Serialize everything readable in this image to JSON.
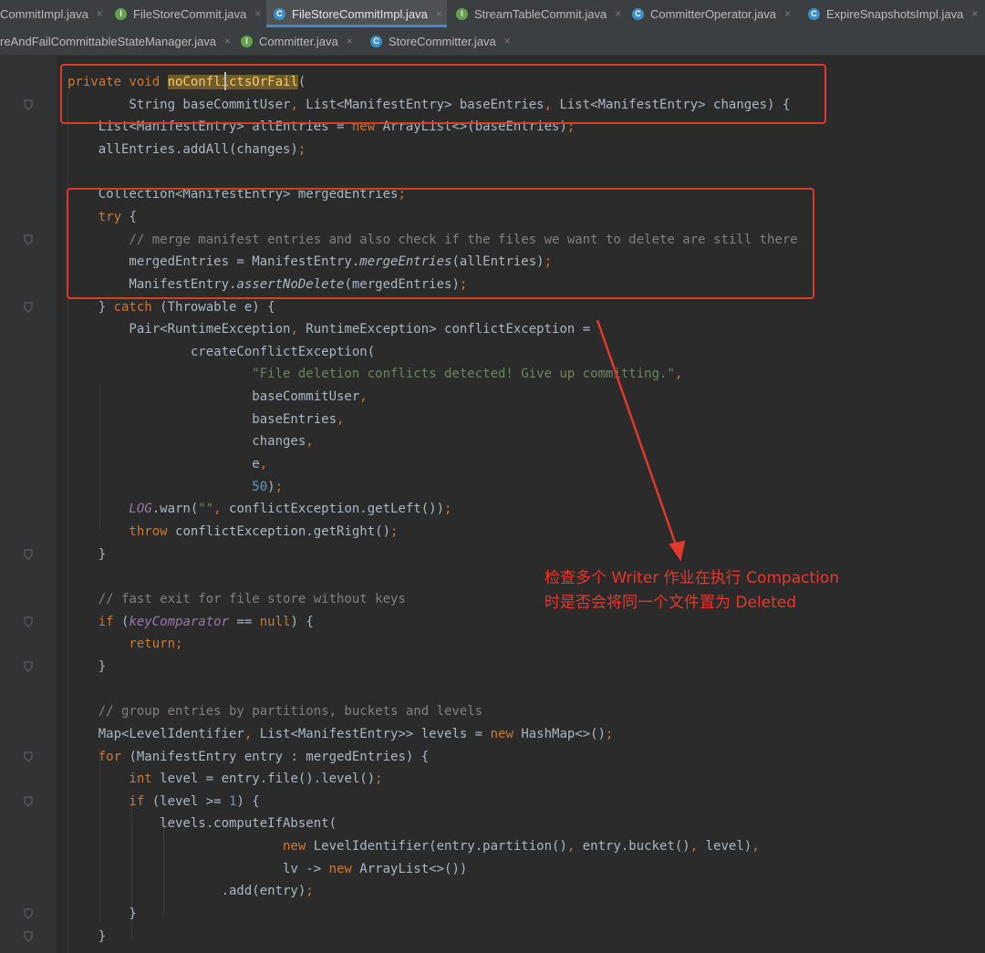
{
  "tabs_row1": [
    {
      "label": "CommitImpl.java",
      "icon": "class-icon",
      "active": false
    },
    {
      "label": "FileStoreCommit.java",
      "icon": "interface-icon",
      "active": false
    },
    {
      "label": "FileStoreCommitImpl.java",
      "icon": "class-icon",
      "active": true
    },
    {
      "label": "StreamTableCommit.java",
      "icon": "interface-icon",
      "active": false
    },
    {
      "label": "CommitterOperator.java",
      "icon": "class-icon",
      "active": false
    },
    {
      "label": "ExpireSnapshotsImpl.java",
      "icon": "class-icon",
      "active": false
    }
  ],
  "tabs_row2": [
    {
      "label": "reAndFailCommittableStateManager.java",
      "icon": "class-icon",
      "active": false
    },
    {
      "label": "Committer.java",
      "icon": "interface-icon",
      "active": false
    },
    {
      "label": "StoreCommitter.java",
      "icon": "class-icon",
      "active": false
    }
  ],
  "close_glyph": "×",
  "code_lines": [
    [
      [
        "kw",
        "private void "
      ],
      [
        "hl",
        "noConflictsOrFail"
      ],
      [
        "pl",
        "("
      ]
    ],
    [
      [
        "pl",
        "        String baseCommitUser"
      ],
      [
        "kw",
        ", "
      ],
      [
        "pl",
        "List<ManifestEntry> baseEntries"
      ],
      [
        "kw",
        ", "
      ],
      [
        "pl",
        "List<ManifestEntry> changes) {"
      ]
    ],
    [
      [
        "pl",
        "    List<ManifestEntry> allEntries = "
      ],
      [
        "kw",
        "new "
      ],
      [
        "pl",
        "ArrayList<>(baseEntries)"
      ],
      [
        "kw",
        ";"
      ]
    ],
    [
      [
        "pl",
        "    allEntries.addAll(changes)"
      ],
      [
        "kw",
        ";"
      ]
    ],
    [],
    [
      [
        "pl",
        "    Collection<ManifestEntry> mergedEntries"
      ],
      [
        "kw",
        ";"
      ]
    ],
    [
      [
        "kw",
        "    try "
      ],
      [
        "pl",
        "{"
      ]
    ],
    [
      [
        "cm",
        "        // merge manifest entries and also check if the files we want to delete are still there"
      ]
    ],
    [
      [
        "pl",
        "        mergedEntries = ManifestEntry."
      ],
      [
        "it",
        "mergeEntries"
      ],
      [
        "pl",
        "(allEntries)"
      ],
      [
        "kw",
        ";"
      ]
    ],
    [
      [
        "pl",
        "        ManifestEntry."
      ],
      [
        "it",
        "assertNoDelete"
      ],
      [
        "pl",
        "(mergedEntries)"
      ],
      [
        "kw",
        ";"
      ]
    ],
    [
      [
        "pl",
        "    } "
      ],
      [
        "kw",
        "catch "
      ],
      [
        "pl",
        "(Throwable e) {"
      ]
    ],
    [
      [
        "pl",
        "        Pair<RuntimeException"
      ],
      [
        "kw",
        ", "
      ],
      [
        "pl",
        "RuntimeException> conflictException ="
      ]
    ],
    [
      [
        "pl",
        "                createConflictException("
      ]
    ],
    [
      [
        "str",
        "                        \"File deletion conflicts detected! Give up committing.\""
      ],
      [
        "kw",
        ","
      ]
    ],
    [
      [
        "pl",
        "                        baseCommitUser"
      ],
      [
        "kw",
        ","
      ]
    ],
    [
      [
        "pl",
        "                        baseEntries"
      ],
      [
        "kw",
        ","
      ]
    ],
    [
      [
        "pl",
        "                        changes"
      ],
      [
        "kw",
        ","
      ]
    ],
    [
      [
        "pl",
        "                        e"
      ],
      [
        "kw",
        ","
      ]
    ],
    [
      [
        "num",
        "                        50"
      ],
      [
        "pl",
        ")"
      ],
      [
        "kw",
        ";"
      ]
    ],
    [
      [
        "st",
        "        LOG"
      ],
      [
        "pl",
        ".warn("
      ],
      [
        "str",
        "\"\""
      ],
      [
        "kw",
        ", "
      ],
      [
        "pl",
        "conflictException.getLeft())"
      ],
      [
        "kw",
        ";"
      ]
    ],
    [
      [
        "kw",
        "        throw "
      ],
      [
        "pl",
        "conflictException.getRight()"
      ],
      [
        "kw",
        ";"
      ]
    ],
    [
      [
        "pl",
        "    }"
      ]
    ],
    [],
    [
      [
        "cm",
        "    // fast exit for file store without keys"
      ]
    ],
    [
      [
        "kw",
        "    if "
      ],
      [
        "pl",
        "("
      ],
      [
        "st",
        "keyComparator"
      ],
      [
        "pl",
        " == "
      ],
      [
        "kw",
        "null"
      ],
      [
        "pl",
        ") {"
      ]
    ],
    [
      [
        "kw",
        "        return;"
      ]
    ],
    [
      [
        "pl",
        "    }"
      ]
    ],
    [],
    [
      [
        "cm",
        "    // group entries by partitions, buckets and levels"
      ]
    ],
    [
      [
        "pl",
        "    Map<LevelIdentifier"
      ],
      [
        "kw",
        ", "
      ],
      [
        "pl",
        "List<ManifestEntry>> levels = "
      ],
      [
        "kw",
        "new "
      ],
      [
        "pl",
        "HashMap<>()"
      ],
      [
        "kw",
        ";"
      ]
    ],
    [
      [
        "kw",
        "    for "
      ],
      [
        "pl",
        "(ManifestEntry entry : mergedEntries) {"
      ]
    ],
    [
      [
        "kw",
        "        int "
      ],
      [
        "pl",
        "level = entry.file().level()"
      ],
      [
        "kw",
        ";"
      ]
    ],
    [
      [
        "kw",
        "        if "
      ],
      [
        "pl",
        "(level >= "
      ],
      [
        "num",
        "1"
      ],
      [
        "pl",
        ") {"
      ]
    ],
    [
      [
        "pl",
        "            levels.computeIfAbsent("
      ]
    ],
    [
      [
        "kw",
        "                            new "
      ],
      [
        "pl",
        "LevelIdentifier(entry.partition()"
      ],
      [
        "kw",
        ", "
      ],
      [
        "pl",
        "entry.bucket()"
      ],
      [
        "kw",
        ", "
      ],
      [
        "pl",
        "level)"
      ],
      [
        "kw",
        ","
      ]
    ],
    [
      [
        "pl",
        "                            lv -> "
      ],
      [
        "kw",
        "new "
      ],
      [
        "pl",
        "ArrayList<>())"
      ]
    ],
    [
      [
        "pl",
        "                    .add(entry)"
      ],
      [
        "kw",
        ";"
      ]
    ],
    [
      [
        "pl",
        "        }"
      ]
    ],
    [
      [
        "pl",
        "    }"
      ]
    ]
  ],
  "annotation": {
    "line1": "检查多个 Writer 作业在执行 Compaction",
    "line2": "时是否会将同一个文件置为 Deleted",
    "color": "#e8372a"
  },
  "colors": {
    "keyword": "#cc7832",
    "method": "#ffc66d",
    "string": "#6a8759",
    "number": "#6897bb",
    "comment": "#808080",
    "static_field": "#9876aa",
    "plain": "#a9b7c6",
    "background": "#2b2b2b",
    "annotation_red": "#e0392b"
  }
}
